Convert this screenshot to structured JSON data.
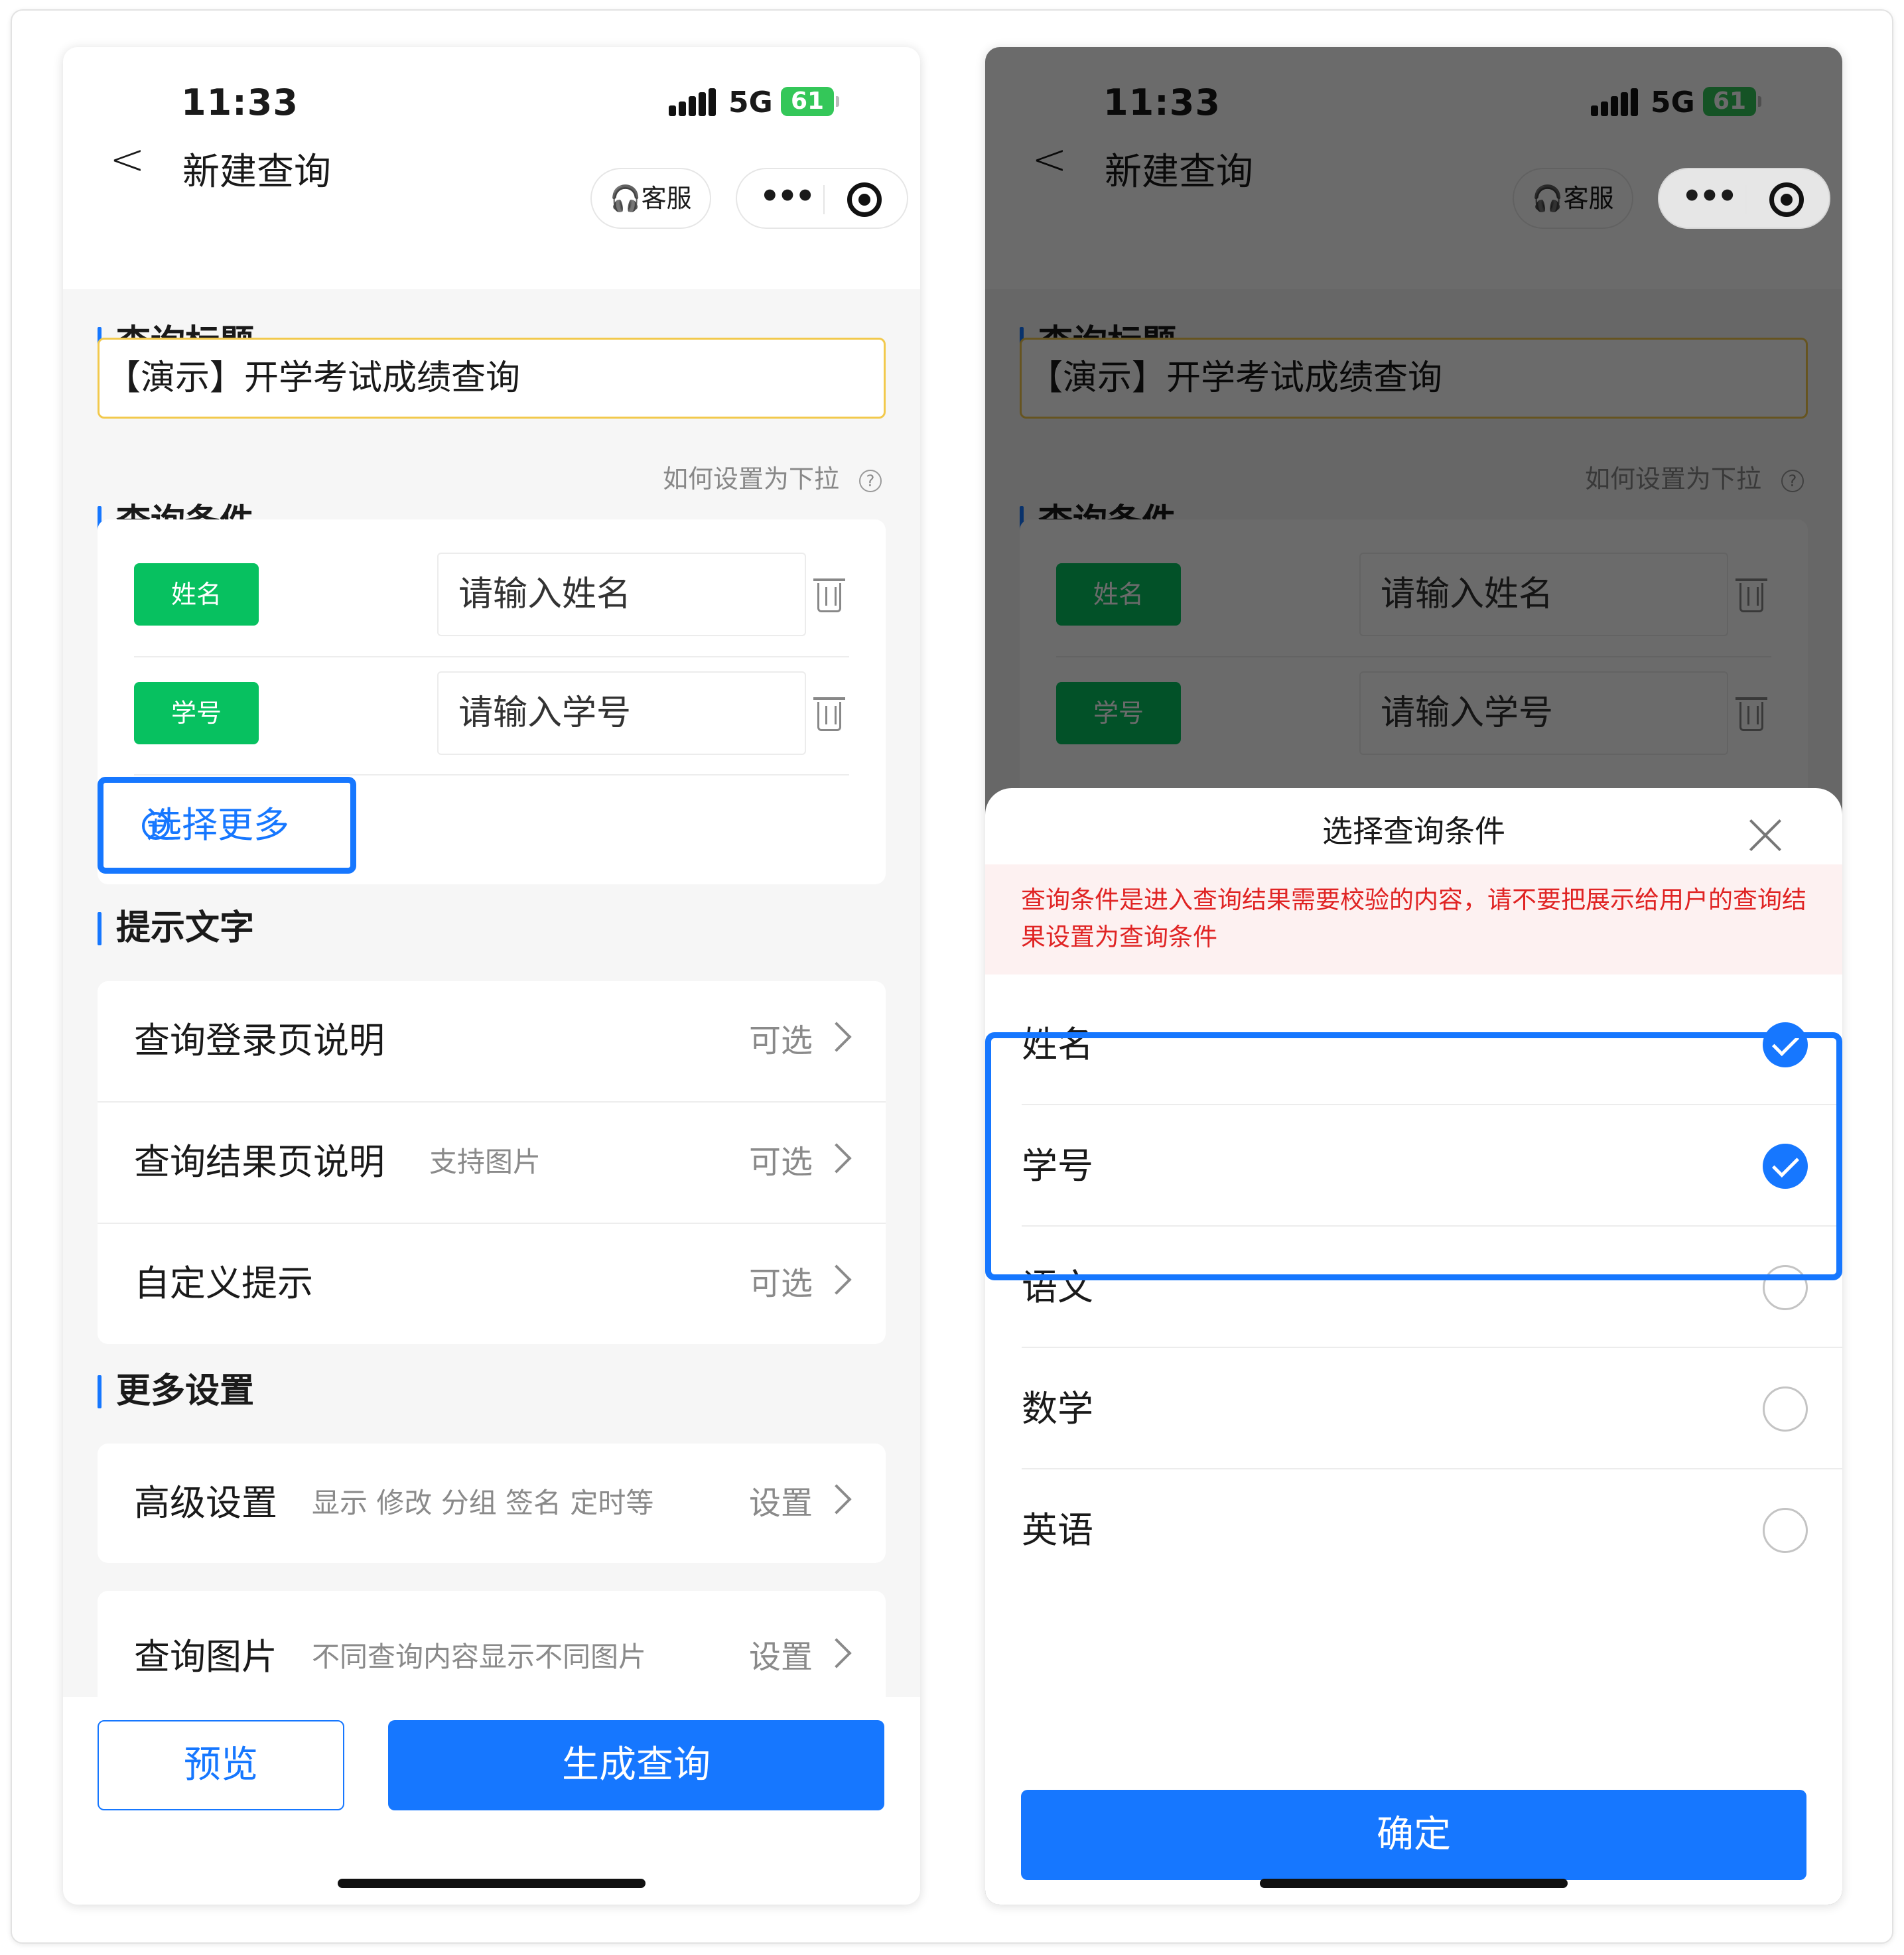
{
  "status": {
    "time": "11:33",
    "network": "5G",
    "battery": "61"
  },
  "nav": {
    "title": "新建查询",
    "service_label": "客服",
    "back_glyph": "<"
  },
  "left": {
    "section_title": "查询标题",
    "title_value": "【演示】开学考试成绩查询",
    "section_conditions": "查询条件",
    "help_link": "如何设置为下拉",
    "conditions": [
      {
        "tag": "姓名",
        "placeholder": "请输入姓名"
      },
      {
        "tag": "学号",
        "placeholder": "请输入学号"
      }
    ],
    "more_button": "选择更多",
    "section_tips": "提示文字",
    "tips": [
      {
        "label": "查询登录页说明",
        "hint": "",
        "right": "可选"
      },
      {
        "label": "查询结果页说明",
        "hint": "支持图片",
        "right": "可选"
      },
      {
        "label": "自定义提示",
        "hint": "",
        "right": "可选"
      }
    ],
    "section_more": "更多设置",
    "settings": [
      {
        "label": "高级设置",
        "hint": "显示 修改 分组 签名 定时等",
        "right": "设置"
      },
      {
        "label": "查询图片",
        "hint": "不同查询内容显示不同图片",
        "right": "设置"
      }
    ],
    "preview_button": "预览",
    "generate_button": "生成查询"
  },
  "sheet": {
    "title": "选择查询条件",
    "warning": "查询条件是进入查询结果需要校验的内容，请不要把展示给用户的查询结果设置为查询条件",
    "options": [
      {
        "label": "姓名",
        "checked": true
      },
      {
        "label": "学号",
        "checked": true
      },
      {
        "label": "语文",
        "checked": false
      },
      {
        "label": "数学",
        "checked": false
      },
      {
        "label": "英语",
        "checked": false
      }
    ],
    "confirm_button": "确定"
  },
  "colors": {
    "primary": "#1677ff",
    "tag_green": "#07c160",
    "warning_red": "#e02424",
    "title_border": "#f2c94c"
  }
}
